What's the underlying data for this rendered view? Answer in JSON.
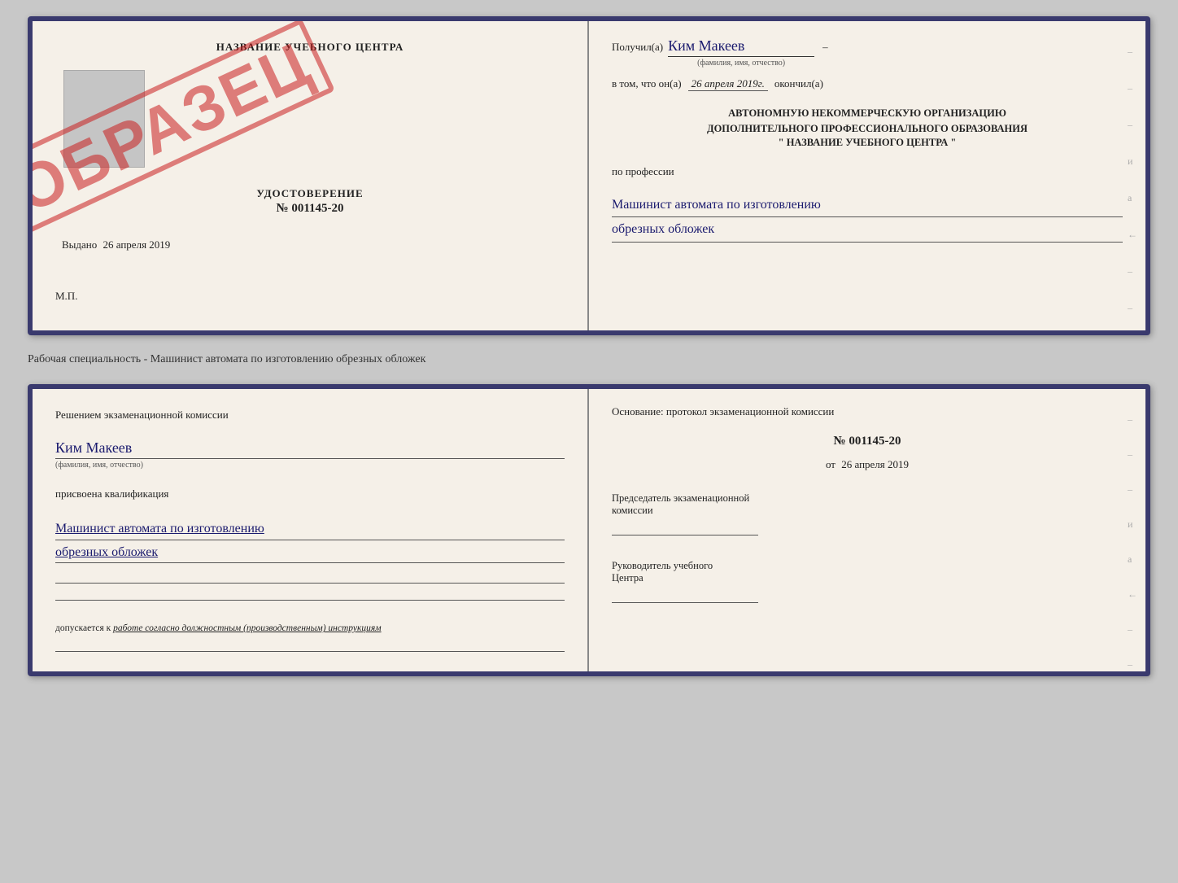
{
  "topCard": {
    "left": {
      "centerTitle": "НАЗВАНИЕ УЧЕБНОГО ЦЕНТРА",
      "udostoverenie": "УДОСТОВЕРЕНИЕ",
      "number": "№ 001145-20",
      "vydano": "Выдано",
      "vydanoDate": "26 апреля 2019",
      "mp": "М.П."
    },
    "right": {
      "poluchilLabel": "Получил(а)",
      "name": "Ким Макеев",
      "fioLabel": "(фамилия, имя, отчество)",
      "vtomLabel": "в том, что он(а)",
      "date": "26 апреля 2019г.",
      "okoncilLabel": "окончил(а)",
      "orgLine1": "АВТОНОМНУЮ НЕКОММЕРЧЕСКУЮ ОРГАНИЗАЦИЮ",
      "orgLine2": "ДОПОЛНИТЕЛЬНОГО ПРОФЕССИОНАЛЬНОГО ОБРАЗОВАНИЯ",
      "orgName": "\" НАЗВАНИЕ УЧЕБНОГО ЦЕНТРА \"",
      "poProfessii": "по профессии",
      "profession1": "Машинист автомата по изготовлению",
      "profession2": "обрезных обложек"
    }
  },
  "separatorLabel": "Рабочая специальность - Машинист автомата по изготовлению обрезных обложек",
  "bottomCard": {
    "left": {
      "reshenjem": "Решением экзаменационной комиссии",
      "name": "Ким Макеев",
      "fioLabel": "(фамилия, имя, отчество)",
      "prisvoena": "присвоена квалификация",
      "profession1": "Машинист автомата по изготовлению",
      "profession2": "обрезных обложек",
      "dopusk": "допускается к",
      "dopuskItalic": "работе согласно должностным (производственным) инструкциям"
    },
    "right": {
      "osnovanie": "Основание: протокол экзаменационной комиссии",
      "protocolNum": "№ 001145-20",
      "ot": "от",
      "date": "26 апреля 2019",
      "predsedatel1": "Председатель экзаменационной",
      "predsedatel2": "комиссии",
      "rukovoditel1": "Руководитель учебного",
      "rukovoditel2": "Центра"
    }
  },
  "obrazets": "ОБРАЗЕЦ",
  "dashes": [
    "-",
    "-",
    "-",
    "и",
    "а",
    "←",
    "-",
    "-",
    "-",
    "-"
  ]
}
